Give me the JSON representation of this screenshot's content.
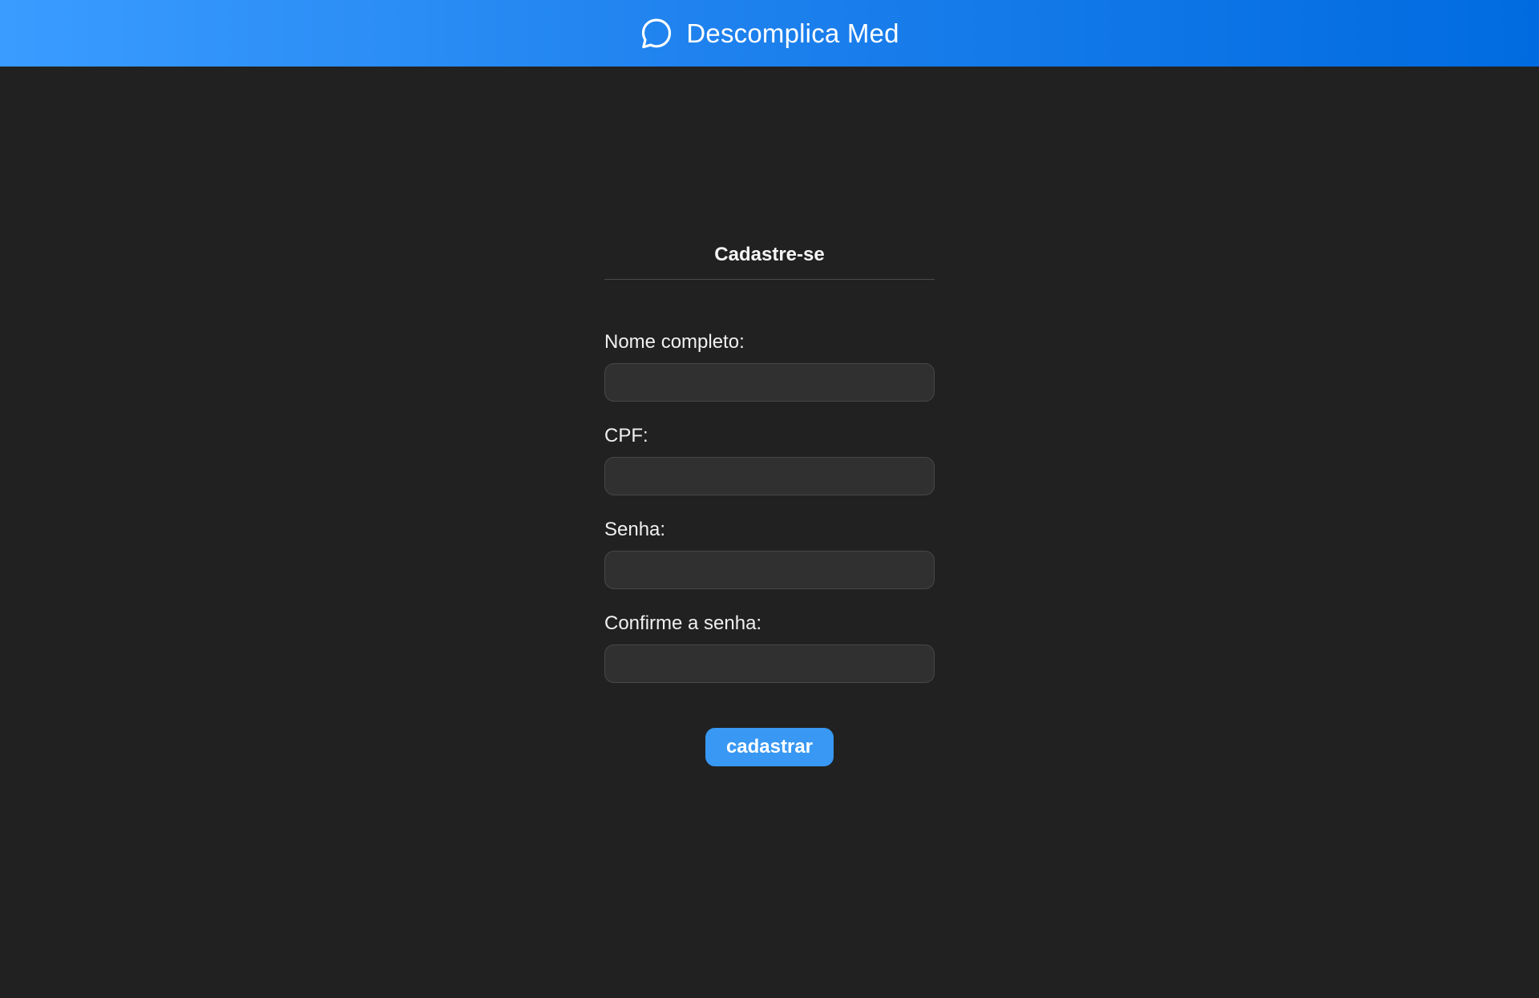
{
  "header": {
    "brand_name": "Descomplica Med",
    "brand_icon": "chat-bubble-icon"
  },
  "form": {
    "title": "Cadastre-se",
    "fields": [
      {
        "label": "Nome completo:",
        "value": "",
        "placeholder": ""
      },
      {
        "label": "CPF:",
        "value": "",
        "placeholder": ""
      },
      {
        "label": "Senha:",
        "value": "",
        "placeholder": ""
      },
      {
        "label": "Confirme a senha:",
        "value": "",
        "placeholder": ""
      }
    ],
    "submit_label": "cadastrar"
  },
  "colors": {
    "header_gradient_start": "#3a9cff",
    "header_gradient_end": "#006be0",
    "background": "#212121",
    "input_background": "#303030",
    "button": "#3898f3"
  }
}
